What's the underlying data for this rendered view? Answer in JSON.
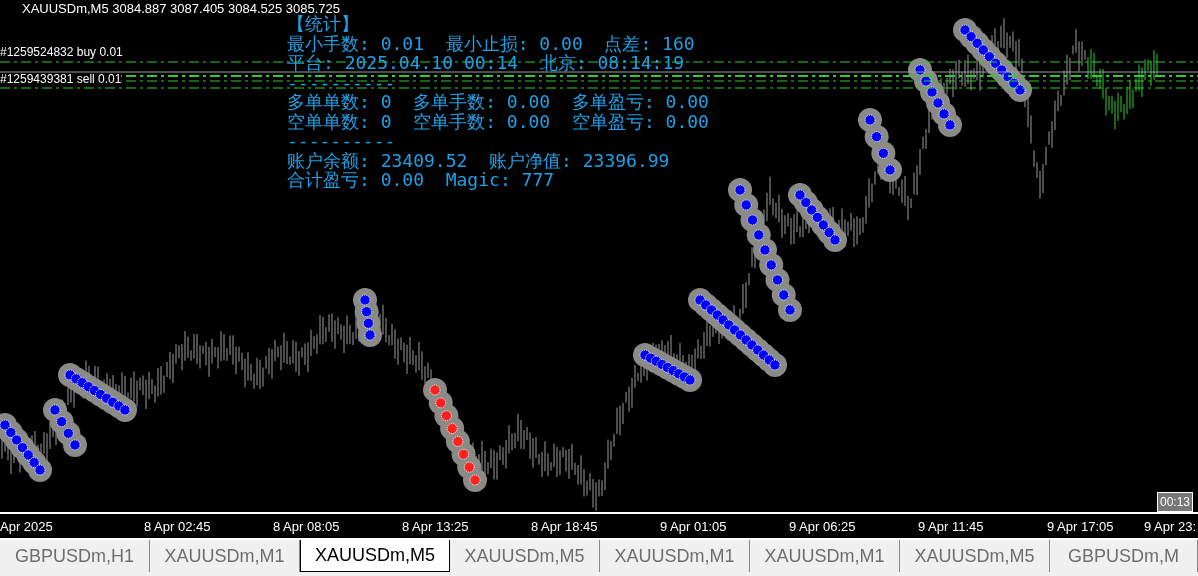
{
  "chart_header": "XAUUSDm,M5  3084.887 3087.405 3084.525 3085.725",
  "order_labels": [
    "#1259524832 buy 0.01",
    "#1259439381 sell 0.01"
  ],
  "stats": {
    "title": "【统计】",
    "lines": [
      "最小手数: 0.01  最小止损: 0.00  点差: 160",
      "平台: 2025.04.10 00:14  北京: 08:14:19",
      "----------",
      "多单单数: 0  多单手数: 0.00  多单盈亏: 0.00",
      "空单单数: 0  空单手数: 0.00  空单盈亏: 0.00",
      "----------",
      "账户余额: 23409.52  账户净值: 23396.99",
      "合计盈亏: 0.00  Magic: 777"
    ]
  },
  "time_badge": "00:13",
  "time_axis": [
    "Apr 2025",
    "8 Apr 02:45",
    "8 Apr 08:05",
    "8 Apr 13:25",
    "8 Apr 18:45",
    "9 Apr 01:05",
    "9 Apr 06:25",
    "9 Apr 11:45",
    "9 Apr 17:05",
    "9 Apr 23:"
  ],
  "tabs": [
    {
      "label": "GBPUSDm,H1",
      "selected": false
    },
    {
      "label": "XAUUSDm,M1",
      "selected": false
    },
    {
      "label": "XAUUSDm,M5",
      "selected": true
    },
    {
      "label": "XAUUSDm,M5",
      "selected": false
    },
    {
      "label": "XAUUSDm,M1",
      "selected": false
    },
    {
      "label": "XAUUSDm,M1",
      "selected": false
    },
    {
      "label": "XAUUSDm,M5",
      "selected": false
    },
    {
      "label": "GBPUSDm,M",
      "selected": false
    }
  ]
}
